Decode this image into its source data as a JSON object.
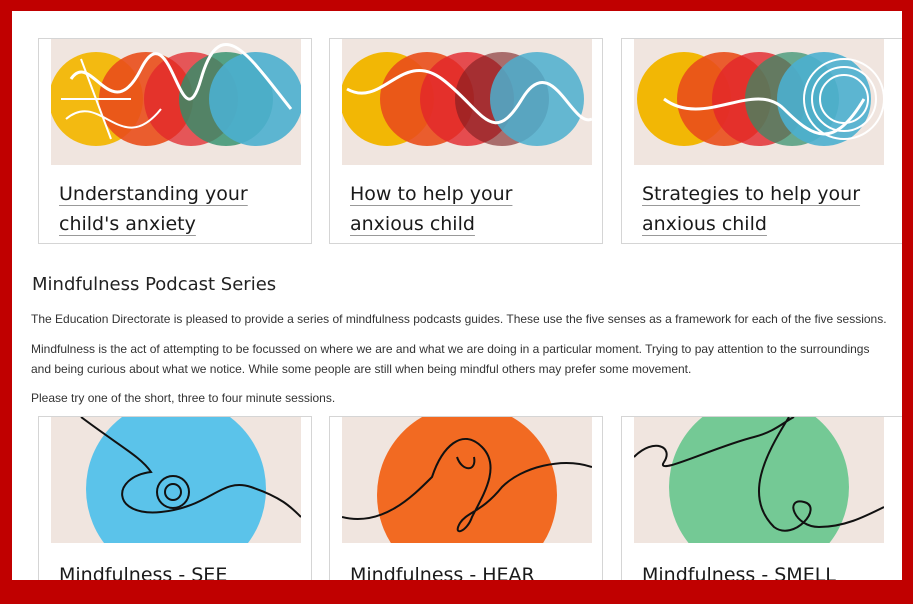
{
  "top_cards": [
    {
      "title": "Understanding your child's anxiety"
    },
    {
      "title": "How to help your anxious child"
    },
    {
      "title": "Strategies to help your anxious child"
    }
  ],
  "section": {
    "heading": "Mindfulness Podcast Series",
    "paragraphs": [
      "The Education Directorate is pleased to provide a series of mindfulness podcasts guides. These use the five senses as a framework for each of the five sessions.",
      "Mindfulness is the act of attempting to be focussed on where we are and what we are doing in a particular moment. Trying to pay attention to the surroundings and being curious about what we notice. While some people are still when being mindful others may prefer some movement.",
      "Please try one of the short, three to four minute sessions."
    ]
  },
  "podcast_cards": [
    {
      "title": "Mindfulness - SEE",
      "circle_color": "#5bc3ea"
    },
    {
      "title": "Mindfulness - HEAR",
      "circle_color": "#f26a22"
    },
    {
      "title": "Mindfulness - SMELL",
      "circle_color": "#74c995"
    }
  ],
  "colors": {
    "frame": "#c00000",
    "image_bg": "#f0e5df",
    "circle_yellow": "#f2b705",
    "circle_orange": "#e94e1b",
    "circle_red": "#e2262b",
    "circle_darkred": "#7a1d1f",
    "circle_green": "#2e8f6a",
    "circle_teal": "#4bafcf"
  }
}
